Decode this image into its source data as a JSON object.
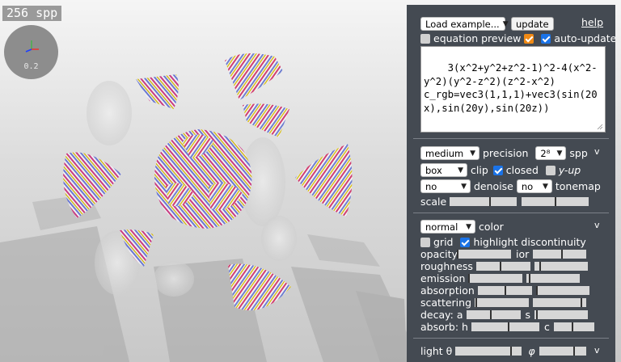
{
  "viewport": {
    "spp_readout": "256 spp",
    "gizmo_scale": "0.2"
  },
  "panel": {
    "example_select": "Load example...",
    "update_button": "update",
    "help_link": "help",
    "equation_preview_label": "equation preview",
    "equation_preview_checked": true,
    "auto_update_label": "auto-update",
    "auto_update_checked": true,
    "equation_text": "3(x^2+y^2+z^2-1)^2-4(x^2-y^2)(y^2-z^2)(z^2-x^2)\nc_rgb=vec3(1,1,1)+vec3(sin(20x),sin(20y),sin(20z))",
    "render": {
      "precision_select": "medium",
      "precision_label": "precision",
      "spp_select": "2⁸",
      "spp_label": "spp",
      "clip_select": "box",
      "clip_label": "clip",
      "closed_label": "closed",
      "closed_checked": true,
      "yup_label": "y-up",
      "yup_checked": false,
      "denoise_select": "no",
      "denoise_label": "denoise",
      "tonemap_select": "no",
      "tonemap_label": "tonemap",
      "scale_label": "scale",
      "collapse": "v"
    },
    "material": {
      "color_select": "normal",
      "color_label": "color",
      "grid_label": "grid",
      "grid_checked": false,
      "highlight_label": "highlight discontinuity",
      "highlight_checked": true,
      "opacity_label": "opacity",
      "ior_label": "ior",
      "roughness_label": "roughness",
      "emission_label": "emission",
      "absorption_label": "absorption",
      "scattering_label": "scattering",
      "decay_label": "decay: a",
      "decay_s_label": "s",
      "absorb_label": "absorb: h",
      "absorb_c_label": "c",
      "collapse": "v",
      "sliders": {
        "scale_1": 0.6,
        "scale_2": 0.5,
        "opacity": 0.0,
        "ior": 0.55,
        "roughness": 0.45,
        "roughness_2": 0.1,
        "emission": 0.0,
        "emission_2": 0.05,
        "absorption": 0.5,
        "absorption_2": 0.0,
        "scattering": 0.02,
        "scattering_2": 0.92,
        "decay_a": 0.45,
        "decay_s": 0.03,
        "absorb_h": 0.55,
        "absorb_c": 0.45
      }
    },
    "light": {
      "theta_label": "light θ",
      "phi_label": "φ",
      "collapse": "v",
      "theta_value": 0.85,
      "phi_value": 0.75
    }
  },
  "colors": {
    "panel_bg": "#444a52",
    "checkbox_blue": "#1a73e8",
    "checkbox_orange": "#f08a15"
  }
}
